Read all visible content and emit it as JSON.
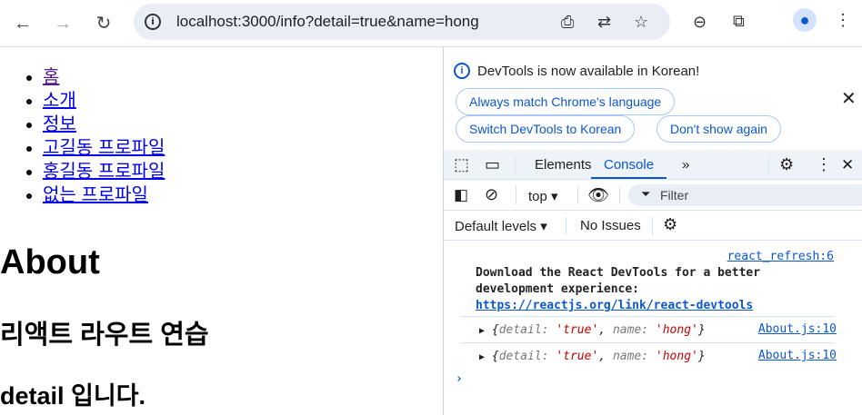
{
  "browser": {
    "url": "localhost:3000/info?detail=true&name=hong"
  },
  "page": {
    "nav": [
      "홈",
      "소개",
      "정보",
      "고길동 프로파일",
      "홍길동 프로파일",
      "없는 프로파일"
    ],
    "h1": "About",
    "h2": "리액트 라우트 연습",
    "h3": "detail 입니다."
  },
  "devtools": {
    "notice": "DevTools is now available in Korean!",
    "btn_match": "Always match Chrome's language",
    "btn_switch": "Switch DevTools to Korean",
    "btn_dont": "Don't show again",
    "tabs": [
      "Elements",
      "Console"
    ],
    "context": "top",
    "filter_placeholder": "Filter",
    "levels": "Default levels",
    "issues": "No Issues",
    "console": {
      "src1": "react_refresh:6",
      "msg1": "Download the React DevTools for a better development experience: ",
      "msg1_link": "https://reactjs.org/link/react-devtools",
      "logs": [
        {
          "k1": "detail",
          "v1": "'true'",
          "k2": "name",
          "v2": "'hong'",
          "src": "About.js:10"
        },
        {
          "k1": "detail",
          "v1": "'true'",
          "k2": "name",
          "v2": "'hong'",
          "src": "About.js:10"
        }
      ]
    }
  },
  "colors": {
    "accent": "#0b57d0",
    "string": "#c80000"
  }
}
